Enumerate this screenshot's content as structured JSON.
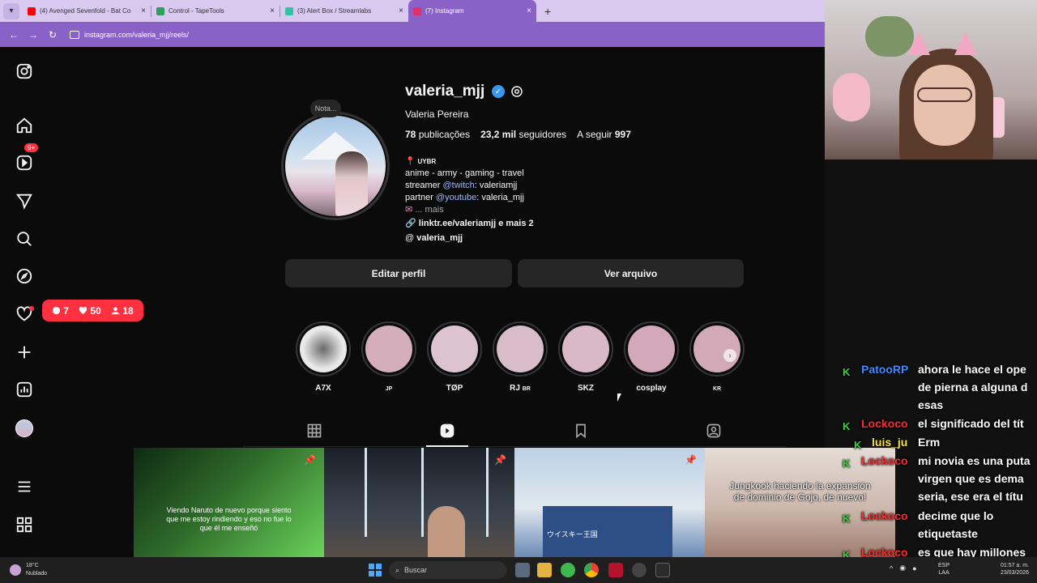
{
  "browser": {
    "tabs": [
      {
        "title": "(4) Avenged Sevenfold - Bat Co",
        "color": "#ff0000"
      },
      {
        "title": "Control - TapeTools",
        "color": "#2e9e5b"
      },
      {
        "title": "(3) Alert Box / Streamlabs",
        "color": "#31c3a2"
      },
      {
        "title": "(7) Instagram",
        "color": "#e1306c"
      }
    ],
    "url": "instagram.com/valeria_mjj/reels/"
  },
  "sidebar": {
    "icons": [
      "instagram-icon",
      "home-icon",
      "reels-icon",
      "messages-icon",
      "search-icon",
      "explore-icon",
      "notifications-icon",
      "create-icon",
      "dashboard-icon",
      "profile-avatar",
      "menu-icon",
      "apps-icon"
    ],
    "messages_badge": "9+",
    "notif_popup": {
      "comments": "7",
      "likes": "50",
      "follows": "18"
    }
  },
  "profile": {
    "note": "Nota...",
    "username": "valeria_mjj",
    "full_name": "Valeria Pereira",
    "posts_count": "78",
    "posts_label": "publicações",
    "followers_count": "23,2 mil",
    "followers_label": "seguidores",
    "following_label": "A seguir",
    "following_count": "997",
    "bio": {
      "location": "UYBR",
      "line1": "anime - army - gaming - travel",
      "line2_prefix": "streamer ",
      "line2_link": "@twitch",
      "line2_suffix": ": valeriamjj",
      "line3_prefix": "partner ",
      "line3_link": "@youtube",
      "line3_suffix": ": valeria_mjj",
      "line4": "... mais",
      "link": "linktr.ee/valeriamjj e mais 2",
      "threads": "valeria_mjj"
    },
    "edit_button": "Editar perfil",
    "archive_button": "Ver arquivo"
  },
  "highlights": [
    {
      "label": "A7X",
      "sub": ""
    },
    {
      "label": "JP",
      "sub": ""
    },
    {
      "label": "TØP",
      "sub": ""
    },
    {
      "label": "RJ",
      "sub": "BR"
    },
    {
      "label": "SKZ",
      "sub": ""
    },
    {
      "label": "cosplay",
      "sub": ""
    },
    {
      "label": "KR",
      "sub": ""
    }
  ],
  "grid": [
    {
      "caption": "Viendo Naruto de nuevo porque siento que me estoy rindiendo y eso no fue lo que él me enseñó"
    },
    {
      "caption": ""
    },
    {
      "caption": "",
      "sign": "ウイスキー王国"
    },
    {
      "caption": "Jungkook haciendo la expansión de dominio de Gojo, de nuevo!"
    }
  ],
  "chat": [
    {
      "user": "PatooRP",
      "user_color": "#3d8bff",
      "lines": [
        "ahora le hace el ope",
        "de pierna a alguna d",
        "esas"
      ]
    },
    {
      "user": "Lockoco",
      "user_color": "#ff2b2b",
      "lines": [
        "el significado del tít"
      ]
    },
    {
      "user": "luis_ju",
      "user_color": "#f5e23a",
      "lines": [
        "Erm"
      ]
    },
    {
      "user": "Lockoco",
      "user_color": "#ff2b2b",
      "lines": [
        "mi novia es una puta",
        "virgen que es dema",
        "seria, ese era el títu"
      ]
    },
    {
      "user": "Lockoco",
      "user_color": "#ff2b2b",
      "lines": [
        "decime que lo",
        "etiquetaste"
      ]
    },
    {
      "user": "Lockoco",
      "user_color": "#ff2b2b",
      "lines": [
        "es que hay millones"
      ]
    }
  ],
  "taskbar": {
    "weather_temp": "18°C",
    "weather_desc": "Nublado",
    "search_placeholder": "Buscar",
    "lang1": "ESP",
    "lang2": "LAA",
    "time": "01:57 a. m.",
    "date": "23/03/2026"
  }
}
